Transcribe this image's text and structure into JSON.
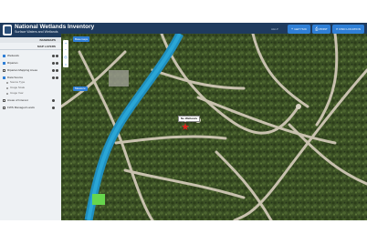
{
  "header": {
    "title": "National Wetlands Inventory",
    "subtitle": "Surface Waters and Wetlands",
    "link_text": "HELP",
    "buttons": [
      {
        "label": "GET HUC",
        "icon": "plus-icon"
      },
      {
        "label": "PRINT",
        "icon": "printer-icon"
      },
      {
        "label": "FIND LOCATION",
        "icon": "search-icon"
      }
    ]
  },
  "panel": {
    "basemaps_label": "BASEMAPS",
    "map_layers_label": "MAP LAYERS",
    "layers": [
      {
        "label": "Wetlands",
        "checked": true
      },
      {
        "label": "Riparian",
        "checked": true
      },
      {
        "label": "Riparian Mapping Areas",
        "checked": false
      },
      {
        "label": "Data Source",
        "checked": true
      }
    ],
    "sublayers": [
      "Source Type",
      "Image Scale",
      "Image Year"
    ],
    "more_layers": [
      {
        "label": "Areas of Interest",
        "checked": false
      },
      {
        "label": "FWS Managed Lands",
        "checked": false
      }
    ]
  },
  "map": {
    "basemap_button": "Basemaps",
    "measure_button": "Measure",
    "marker_label": "No Wetlands",
    "marker_color": "#e0231c",
    "canal_color": "#1f8fbf"
  }
}
